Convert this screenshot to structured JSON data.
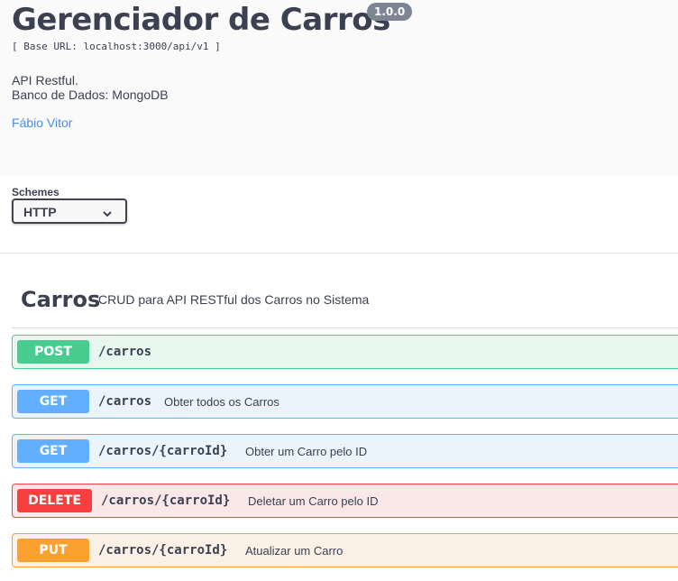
{
  "info": {
    "title": "Gerenciador de Carros",
    "version": "1.0.0",
    "base_url": "[ Base URL: localhost:3000/api/v1 ]",
    "description_lines": [
      "API Restful.",
      "Banco de Dados: MongoDB"
    ],
    "author_link": "Fábio Vitor"
  },
  "schemes": {
    "label": "Schemes",
    "selected": "HTTP",
    "chevron_icon": "chevron-down-icon"
  },
  "tag": {
    "name": "Carros",
    "description": "CRUD para API RESTful dos Carros no Sistema"
  },
  "operations": [
    {
      "method": "POST",
      "path": "/carros",
      "summary": ""
    },
    {
      "method": "GET",
      "path": "/carros",
      "summary": "Obter todos os Carros"
    },
    {
      "method": "GET",
      "path": "/carros/{carroId}",
      "summary": "Obter um Carro pelo ID"
    },
    {
      "method": "DELETE",
      "path": "/carros/{carroId}",
      "summary": "Deletar um Carro pelo ID"
    },
    {
      "method": "PUT",
      "path": "/carros/{carroId}",
      "summary": "Atualizar um Carro"
    }
  ],
  "colors": {
    "post": "#49cc90",
    "get": "#61affe",
    "delete": "#f93e3e",
    "put": "#fca130",
    "link": "#4990e2",
    "text": "#3b4151"
  }
}
